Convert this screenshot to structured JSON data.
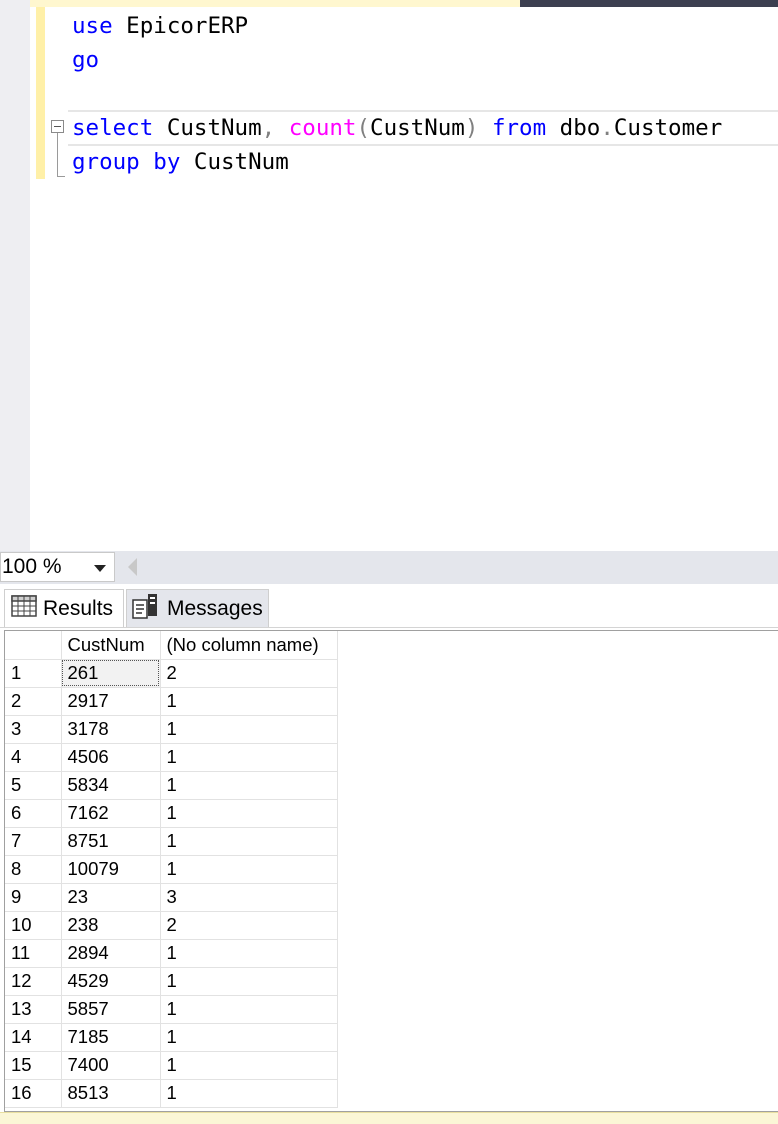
{
  "editor": {
    "lines": [
      {
        "tokens": [
          {
            "t": "use",
            "c": "kw"
          },
          {
            "t": " EpicorERP",
            "c": ""
          }
        ]
      },
      {
        "tokens": [
          {
            "t": "go",
            "c": "kw"
          }
        ]
      },
      {
        "tokens": []
      },
      {
        "tokens": [
          {
            "t": "select",
            "c": "kw"
          },
          {
            "t": " CustNum",
            "c": ""
          },
          {
            "t": ",",
            "c": "punc"
          },
          {
            "t": " ",
            "c": ""
          },
          {
            "t": "count",
            "c": "fn"
          },
          {
            "t": "(",
            "c": "punc"
          },
          {
            "t": "CustNum",
            "c": ""
          },
          {
            "t": ")",
            "c": "punc"
          },
          {
            "t": " ",
            "c": ""
          },
          {
            "t": "from",
            "c": "kw"
          },
          {
            "t": " dbo",
            "c": ""
          },
          {
            "t": ".",
            "c": "punc"
          },
          {
            "t": "Customer",
            "c": ""
          }
        ]
      },
      {
        "tokens": [
          {
            "t": "group by",
            "c": "kw"
          },
          {
            "t": " CustNum",
            "c": ""
          }
        ]
      }
    ]
  },
  "zoom": {
    "value": "100 %"
  },
  "tabs": {
    "results_label": "Results",
    "messages_label": "Messages"
  },
  "grid": {
    "columns": [
      "",
      "CustNum",
      "(No column name)"
    ],
    "rows": [
      [
        "1",
        "261",
        "2"
      ],
      [
        "2",
        "2917",
        "1"
      ],
      [
        "3",
        "3178",
        "1"
      ],
      [
        "4",
        "4506",
        "1"
      ],
      [
        "5",
        "5834",
        "1"
      ],
      [
        "6",
        "7162",
        "1"
      ],
      [
        "7",
        "8751",
        "1"
      ],
      [
        "8",
        "10079",
        "1"
      ],
      [
        "9",
        "23",
        "3"
      ],
      [
        "10",
        "238",
        "2"
      ],
      [
        "11",
        "2894",
        "1"
      ],
      [
        "12",
        "4529",
        "1"
      ],
      [
        "13",
        "5857",
        "1"
      ],
      [
        "14",
        "7185",
        "1"
      ],
      [
        "15",
        "7400",
        "1"
      ],
      [
        "16",
        "8513",
        "1"
      ]
    ]
  },
  "colors": {
    "keyword": "#0000ff",
    "function": "#ff00ff",
    "punctuation": "#808080"
  }
}
